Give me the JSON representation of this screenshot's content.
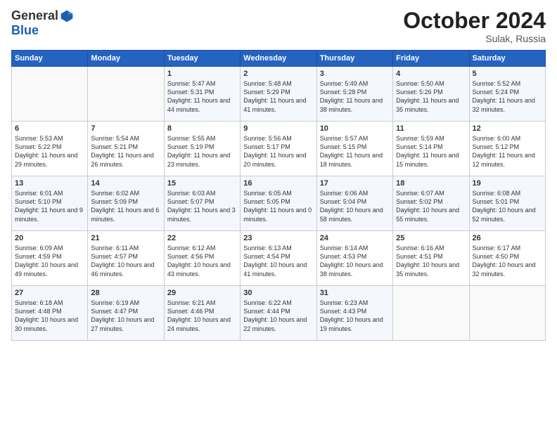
{
  "header": {
    "logo_general": "General",
    "logo_blue": "Blue",
    "month": "October 2024",
    "location": "Sulak, Russia"
  },
  "weekdays": [
    "Sunday",
    "Monday",
    "Tuesday",
    "Wednesday",
    "Thursday",
    "Friday",
    "Saturday"
  ],
  "weeks": [
    [
      {
        "day": "",
        "content": ""
      },
      {
        "day": "",
        "content": ""
      },
      {
        "day": "1",
        "content": "Sunrise: 5:47 AM\nSunset: 5:31 PM\nDaylight: 11 hours and 44 minutes."
      },
      {
        "day": "2",
        "content": "Sunrise: 5:48 AM\nSunset: 5:29 PM\nDaylight: 11 hours and 41 minutes."
      },
      {
        "day": "3",
        "content": "Sunrise: 5:49 AM\nSunset: 5:28 PM\nDaylight: 11 hours and 38 minutes."
      },
      {
        "day": "4",
        "content": "Sunrise: 5:50 AM\nSunset: 5:26 PM\nDaylight: 11 hours and 35 minutes."
      },
      {
        "day": "5",
        "content": "Sunrise: 5:52 AM\nSunset: 5:24 PM\nDaylight: 11 hours and 32 minutes."
      }
    ],
    [
      {
        "day": "6",
        "content": "Sunrise: 5:53 AM\nSunset: 5:22 PM\nDaylight: 11 hours and 29 minutes."
      },
      {
        "day": "7",
        "content": "Sunrise: 5:54 AM\nSunset: 5:21 PM\nDaylight: 11 hours and 26 minutes."
      },
      {
        "day": "8",
        "content": "Sunrise: 5:55 AM\nSunset: 5:19 PM\nDaylight: 11 hours and 23 minutes."
      },
      {
        "day": "9",
        "content": "Sunrise: 5:56 AM\nSunset: 5:17 PM\nDaylight: 11 hours and 20 minutes."
      },
      {
        "day": "10",
        "content": "Sunrise: 5:57 AM\nSunset: 5:15 PM\nDaylight: 11 hours and 18 minutes."
      },
      {
        "day": "11",
        "content": "Sunrise: 5:59 AM\nSunset: 5:14 PM\nDaylight: 11 hours and 15 minutes."
      },
      {
        "day": "12",
        "content": "Sunrise: 6:00 AM\nSunset: 5:12 PM\nDaylight: 11 hours and 12 minutes."
      }
    ],
    [
      {
        "day": "13",
        "content": "Sunrise: 6:01 AM\nSunset: 5:10 PM\nDaylight: 11 hours and 9 minutes."
      },
      {
        "day": "14",
        "content": "Sunrise: 6:02 AM\nSunset: 5:09 PM\nDaylight: 11 hours and 6 minutes."
      },
      {
        "day": "15",
        "content": "Sunrise: 6:03 AM\nSunset: 5:07 PM\nDaylight: 11 hours and 3 minutes."
      },
      {
        "day": "16",
        "content": "Sunrise: 6:05 AM\nSunset: 5:05 PM\nDaylight: 11 hours and 0 minutes."
      },
      {
        "day": "17",
        "content": "Sunrise: 6:06 AM\nSunset: 5:04 PM\nDaylight: 10 hours and 58 minutes."
      },
      {
        "day": "18",
        "content": "Sunrise: 6:07 AM\nSunset: 5:02 PM\nDaylight: 10 hours and 55 minutes."
      },
      {
        "day": "19",
        "content": "Sunrise: 6:08 AM\nSunset: 5:01 PM\nDaylight: 10 hours and 52 minutes."
      }
    ],
    [
      {
        "day": "20",
        "content": "Sunrise: 6:09 AM\nSunset: 4:59 PM\nDaylight: 10 hours and 49 minutes."
      },
      {
        "day": "21",
        "content": "Sunrise: 6:11 AM\nSunset: 4:57 PM\nDaylight: 10 hours and 46 minutes."
      },
      {
        "day": "22",
        "content": "Sunrise: 6:12 AM\nSunset: 4:56 PM\nDaylight: 10 hours and 43 minutes."
      },
      {
        "day": "23",
        "content": "Sunrise: 6:13 AM\nSunset: 4:54 PM\nDaylight: 10 hours and 41 minutes."
      },
      {
        "day": "24",
        "content": "Sunrise: 6:14 AM\nSunset: 4:53 PM\nDaylight: 10 hours and 38 minutes."
      },
      {
        "day": "25",
        "content": "Sunrise: 6:16 AM\nSunset: 4:51 PM\nDaylight: 10 hours and 35 minutes."
      },
      {
        "day": "26",
        "content": "Sunrise: 6:17 AM\nSunset: 4:50 PM\nDaylight: 10 hours and 32 minutes."
      }
    ],
    [
      {
        "day": "27",
        "content": "Sunrise: 6:18 AM\nSunset: 4:48 PM\nDaylight: 10 hours and 30 minutes."
      },
      {
        "day": "28",
        "content": "Sunrise: 6:19 AM\nSunset: 4:47 PM\nDaylight: 10 hours and 27 minutes."
      },
      {
        "day": "29",
        "content": "Sunrise: 6:21 AM\nSunset: 4:46 PM\nDaylight: 10 hours and 24 minutes."
      },
      {
        "day": "30",
        "content": "Sunrise: 6:22 AM\nSunset: 4:44 PM\nDaylight: 10 hours and 22 minutes."
      },
      {
        "day": "31",
        "content": "Sunrise: 6:23 AM\nSunset: 4:43 PM\nDaylight: 10 hours and 19 minutes."
      },
      {
        "day": "",
        "content": ""
      },
      {
        "day": "",
        "content": ""
      }
    ]
  ]
}
